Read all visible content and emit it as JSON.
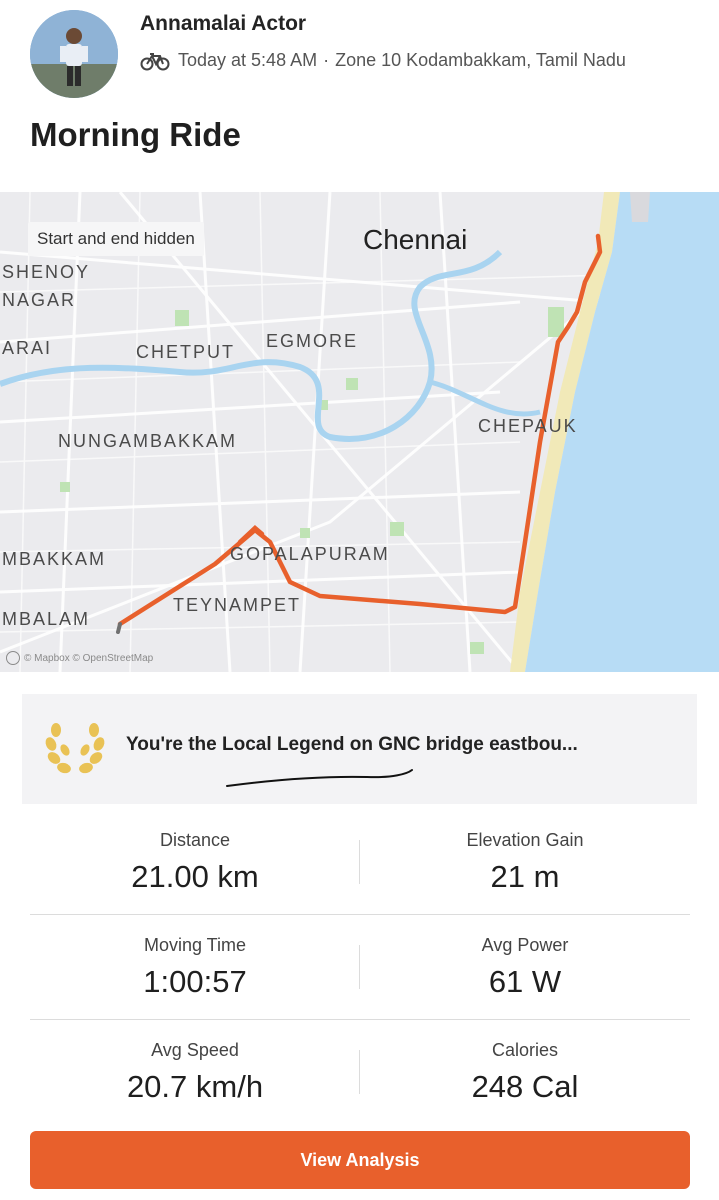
{
  "header": {
    "athlete_name": "Annamalai Actor",
    "time": "Today at 5:48 AM",
    "separator": "·",
    "location": "Zone 10 Kodambakkam, Tamil Nadu"
  },
  "activity": {
    "title": "Morning Ride"
  },
  "map": {
    "privacy_label": "Start and end hidden",
    "city": "Chennai",
    "areas": {
      "shenoy": "SHENOY",
      "nagar": "NAGAR",
      "arai": "ARAI",
      "chetput": "CHETPUT",
      "egmore": "EGMORE",
      "chepauk": "CHEPAUK",
      "nungambakkam": "NUNGAMBAKKAM",
      "mbakkam": "MBAKKAM",
      "gopalapuram": "GOPALAPURAM",
      "teynampet": "TEYNAMPET",
      "mbalam": "MBALAM"
    },
    "attribution": "© Mapbox © OpenStreetMap",
    "route_color": "#e8602c",
    "water_color": "#b7dcf5",
    "beach_color": "#f1e9b8"
  },
  "achievement": {
    "text": "You're the Local Legend on GNC bridge eastbou...",
    "icon": "laurel-icon",
    "icon_color": "#e9c255"
  },
  "stats": [
    {
      "label": "Distance",
      "value": "21.00 km"
    },
    {
      "label": "Elevation Gain",
      "value": "21 m"
    },
    {
      "label": "Moving Time",
      "value": "1:00:57"
    },
    {
      "label": "Avg Power",
      "value": "61 W"
    },
    {
      "label": "Avg Speed",
      "value": "20.7 km/h"
    },
    {
      "label": "Calories",
      "value": "248 Cal"
    }
  ],
  "cta": {
    "label": "View Analysis",
    "color": "#e8602c"
  }
}
